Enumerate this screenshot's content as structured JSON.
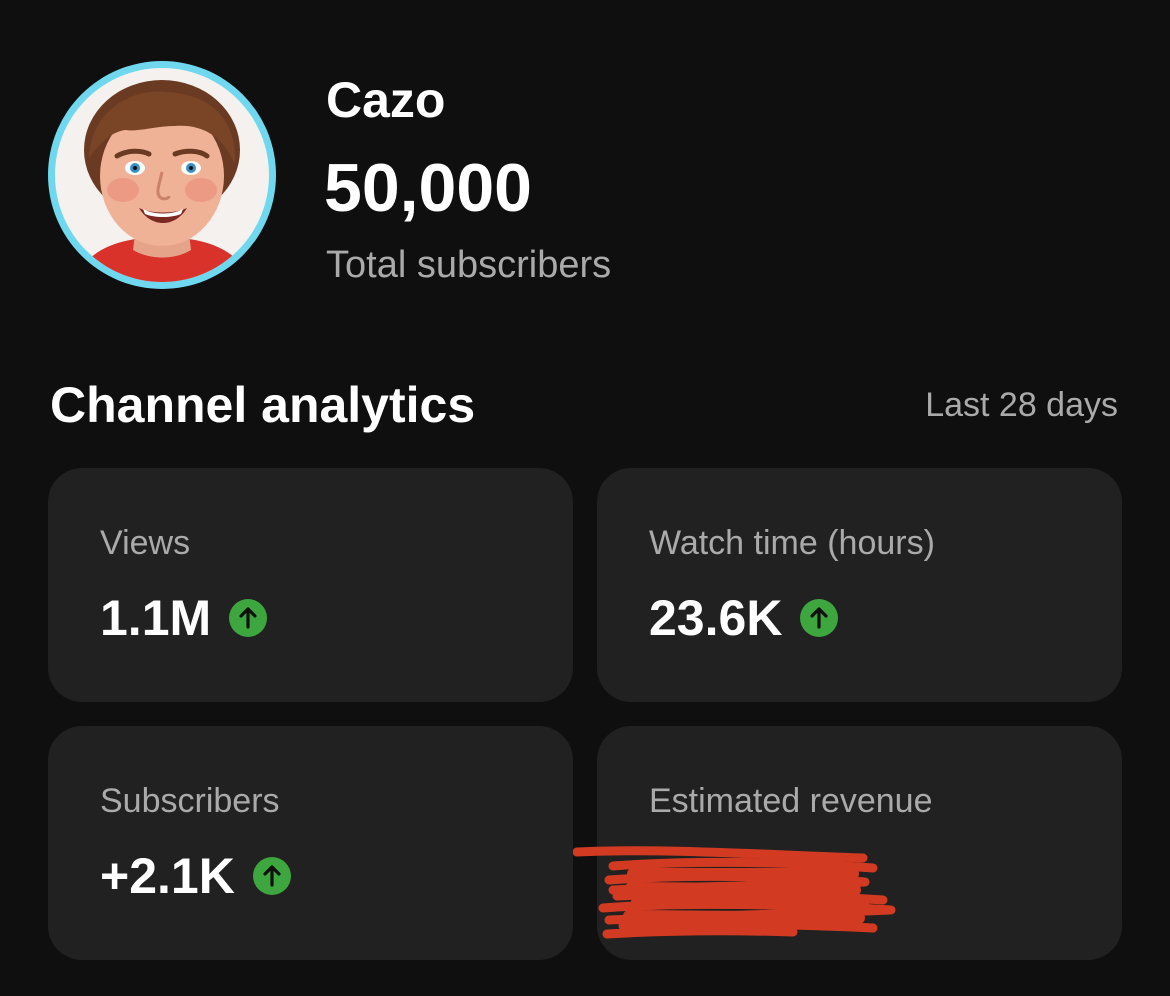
{
  "channel": {
    "name": "Cazo",
    "subscriber_count": "50,000",
    "subscriber_label": "Total subscribers",
    "avatar_ring_color": "#6fd8ef"
  },
  "analytics": {
    "title": "Channel analytics",
    "period": "Last 28 days",
    "trend_color": "#3ea63e",
    "cards": [
      {
        "label": "Views",
        "value": "1.1M",
        "trend": "up",
        "icon": "arrow-up-circle-icon"
      },
      {
        "label": "Watch time (hours)",
        "value": "23.6K",
        "trend": "up",
        "icon": "arrow-up-circle-icon"
      },
      {
        "label": "Subscribers",
        "value": "+2.1K",
        "trend": "up",
        "icon": "arrow-up-circle-icon"
      },
      {
        "label": "Estimated revenue",
        "value": null,
        "redacted": true,
        "redaction_color": "#d23a22"
      }
    ]
  }
}
